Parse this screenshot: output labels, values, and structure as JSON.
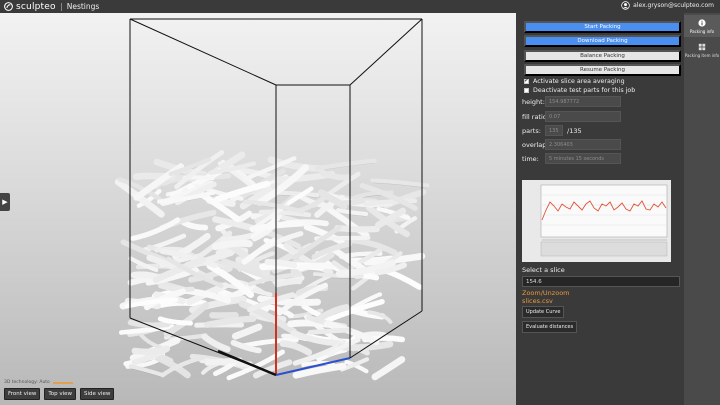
{
  "header": {
    "brand": "sculpteo",
    "app_title": "Nestings",
    "user_email": "alex.gryson@sculpteo.com"
  },
  "viewport": {
    "status_text": "3D technology: Auto",
    "buttons": [
      "Front view",
      "Top view",
      "Side view"
    ]
  },
  "panel": {
    "buttons": {
      "start": "Start Packing",
      "download": "Download Packing",
      "balance": "Balance Packing",
      "resume": "Resume Packing"
    },
    "checkboxes": [
      {
        "label": "Activate slice area averaging",
        "checked": true
      },
      {
        "label": "Deactivate test parts for this job",
        "checked": false
      }
    ],
    "fields": {
      "height": {
        "label": "height:",
        "value": "154.987772"
      },
      "fill_ratio": {
        "label": "fill ratio:",
        "value": "0.07"
      },
      "parts": {
        "label": "parts:",
        "value": "135",
        "total": "/135"
      },
      "overlap": {
        "label": "overlap:",
        "value": "2.306403"
      },
      "time": {
        "label": "time:",
        "value": "5 minutes 15 seconds"
      }
    },
    "slice": {
      "label": "Select a slice",
      "value": "154.6"
    },
    "links": {
      "zoom": "Zoom/Unzoom",
      "slices_csv": "slices.csv"
    },
    "actions": {
      "update_curve": "Update Curve",
      "evaluate": "Evaluate distances"
    }
  },
  "tabs": [
    {
      "label": "Packing info",
      "icon": "info-icon",
      "active": true
    },
    {
      "label": "Packing item info",
      "icon": "grid-icon",
      "active": false
    }
  ],
  "colors": {
    "accent_blue": "#4a8ef0",
    "link_orange": "#e89a3c",
    "axis_red": "#d03020",
    "axis_blue": "#2a4fd0"
  }
}
